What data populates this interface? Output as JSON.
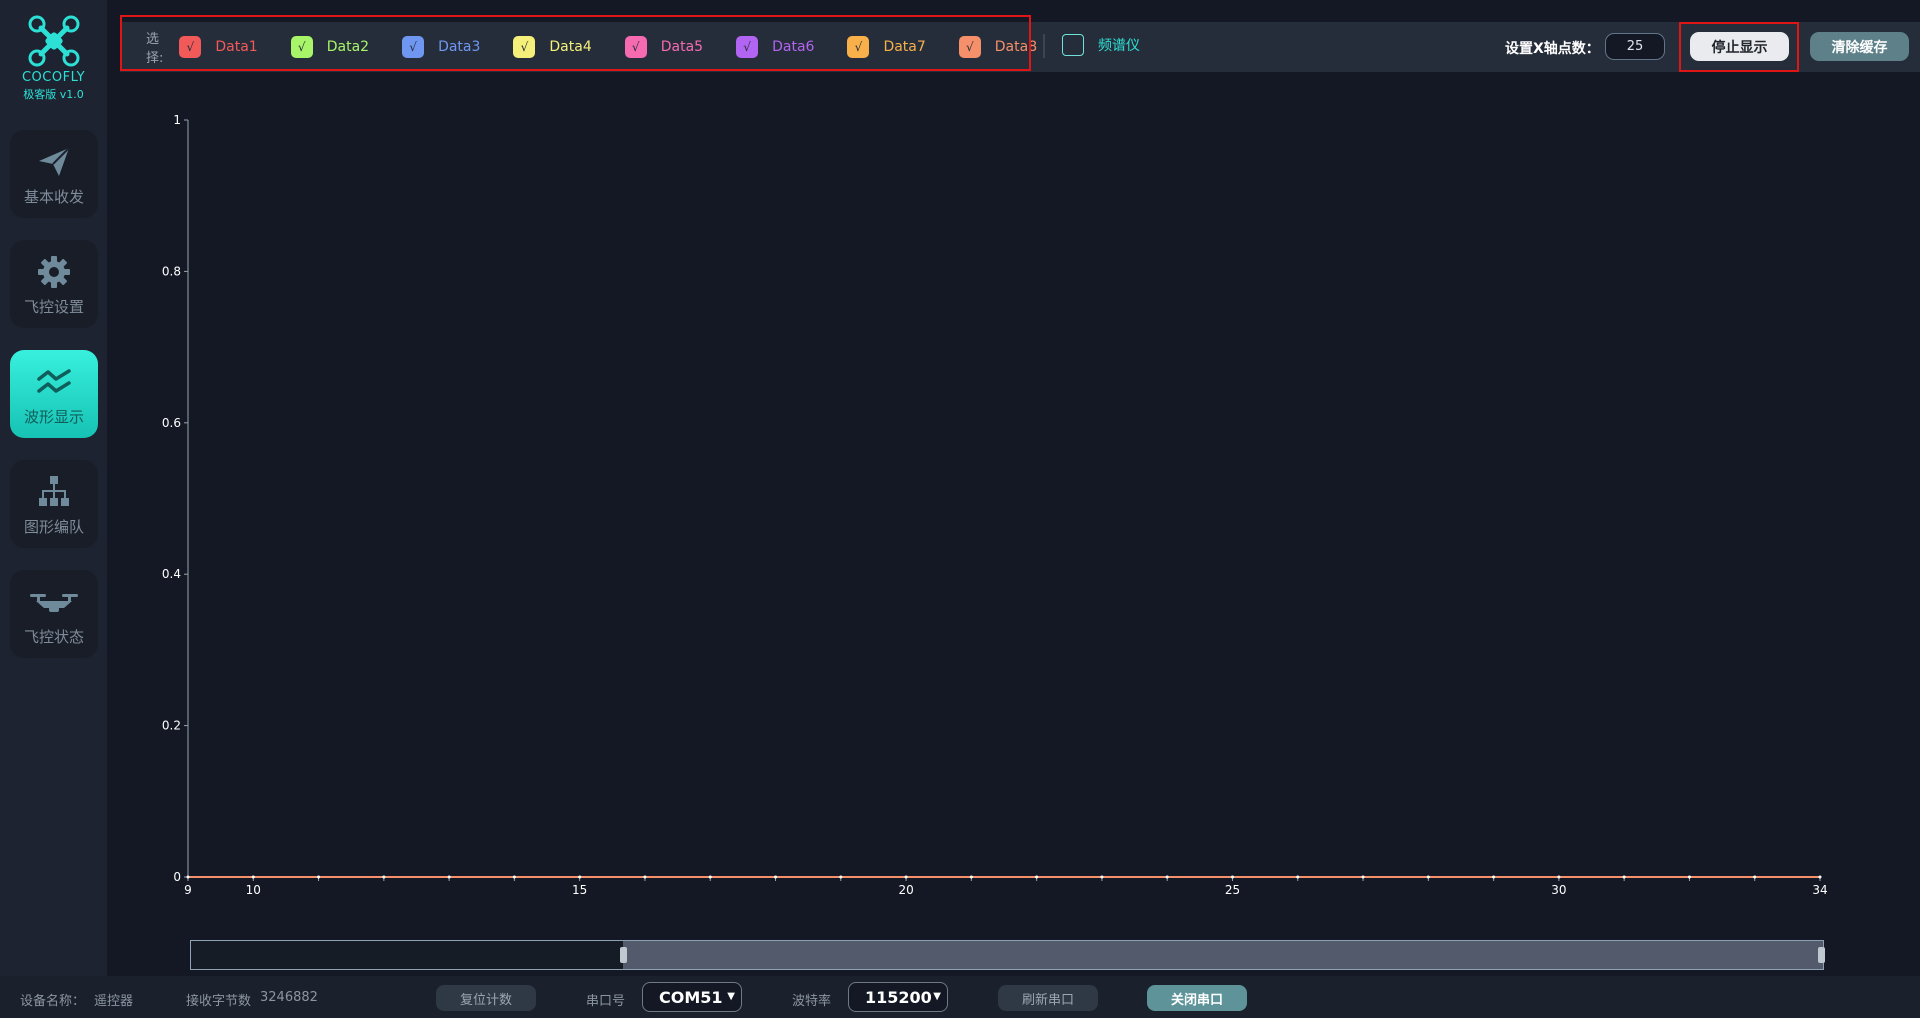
{
  "brand": {
    "name": "COCOFLY",
    "version": "极客版 v1.0",
    "accent": "#2de0d6"
  },
  "sidebar": {
    "items": [
      {
        "label": "基本收发",
        "icon": "paper-plane-icon",
        "active": false
      },
      {
        "label": "飞控设置",
        "icon": "gear-icon",
        "active": false
      },
      {
        "label": "波形显示",
        "icon": "waveform-icon",
        "active": true
      },
      {
        "label": "图形编队",
        "icon": "hierarchy-icon",
        "active": false
      },
      {
        "label": "飞控状态",
        "icon": "drone-icon",
        "active": false
      }
    ]
  },
  "toolbar": {
    "select_label": "选择:",
    "series": [
      {
        "name": "Data1",
        "color": "#f25a5a",
        "checked": true
      },
      {
        "name": "Data2",
        "color": "#a9f56a",
        "checked": true
      },
      {
        "name": "Data3",
        "color": "#6f97f2",
        "checked": true
      },
      {
        "name": "Data4",
        "color": "#f4f07a",
        "checked": true
      },
      {
        "name": "Data5",
        "color": "#f56ab0",
        "checked": true
      },
      {
        "name": "Data6",
        "color": "#b264f2",
        "checked": true
      },
      {
        "name": "Data7",
        "color": "#f7b04a",
        "checked": true
      },
      {
        "name": "Data8",
        "color": "#f5906a",
        "checked": true
      }
    ],
    "checkmark": "√",
    "spectrum_label": "频谱仪",
    "spectrum_checked": false,
    "xpoints_label": "设置X轴点数：",
    "xpoints_value": "25",
    "stop_label": "停止显示",
    "clear_label": "清除缓存"
  },
  "chart_data": {
    "type": "line",
    "x_ticks_major": [
      9,
      10,
      15,
      20,
      25,
      30,
      34
    ],
    "xlim": [
      9,
      34
    ],
    "y_ticks": [
      0,
      0.2,
      0.4,
      0.6,
      0.8,
      1
    ],
    "ylim": [
      0,
      1
    ],
    "x": [
      9,
      10,
      11,
      12,
      13,
      14,
      15,
      16,
      17,
      18,
      19,
      20,
      21,
      22,
      23,
      24,
      25,
      26,
      27,
      28,
      29,
      30,
      31,
      32,
      33,
      34
    ],
    "series": [
      {
        "name": "Data8",
        "color": "#f5906a",
        "values": [
          0,
          0,
          0,
          0,
          0,
          0,
          0,
          0,
          0,
          0,
          0,
          0,
          0,
          0,
          0,
          0,
          0,
          0,
          0,
          0,
          0,
          0,
          0,
          0,
          0,
          0
        ]
      }
    ],
    "grid": false,
    "zoom_range": [
      0.265,
      1.0
    ]
  },
  "status": {
    "device_label": "设备名称：",
    "device_value": "遥控器",
    "received_label": "接收字节数",
    "received_value": "3246882",
    "reset_label": "复位计数",
    "port_label": "串口号",
    "port_value": "COM51",
    "baud_label": "波特率",
    "baud_value": "115200",
    "refresh_label": "刷新串口",
    "close_label": "关闭串口"
  }
}
